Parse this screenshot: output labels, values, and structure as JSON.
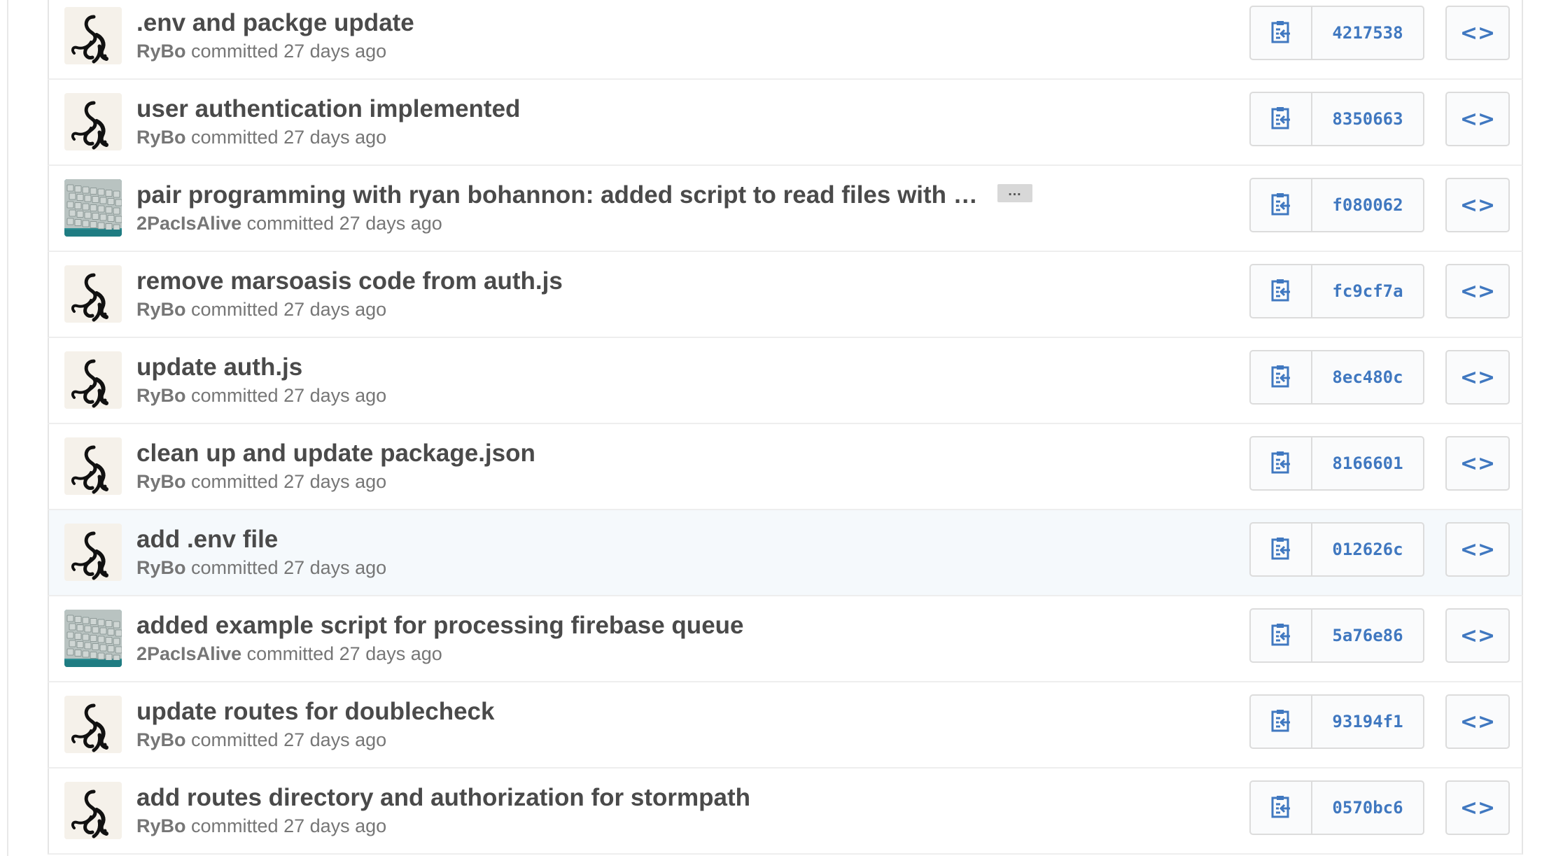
{
  "colors": {
    "link": "#4078c0",
    "title_text": "#4a4a4a",
    "meta_text": "#767676",
    "highlight_row": "#f5f9fc"
  },
  "commits": [
    {
      "title": ".env and packge update",
      "author": "RyBo",
      "meta_suffix": "committed 27 days ago",
      "sha": "4217538",
      "avatar": "octopus",
      "truncated": false,
      "highlight": false
    },
    {
      "title": "user authentication implemented",
      "author": "RyBo",
      "meta_suffix": "committed 27 days ago",
      "sha": "8350663",
      "avatar": "octopus",
      "truncated": false,
      "highlight": false
    },
    {
      "title": "pair programming with ryan bohannon: added script to read files with …",
      "author": "2PacIsAlive",
      "meta_suffix": "committed 27 days ago",
      "sha": "f080062",
      "avatar": "keyboard",
      "truncated": true,
      "ellipsis_label": "…",
      "highlight": false
    },
    {
      "title": "remove marsoasis code from auth.js",
      "author": "RyBo",
      "meta_suffix": "committed 27 days ago",
      "sha": "fc9cf7a",
      "avatar": "octopus",
      "truncated": false,
      "highlight": false
    },
    {
      "title": "update auth.js",
      "author": "RyBo",
      "meta_suffix": "committed 27 days ago",
      "sha": "8ec480c",
      "avatar": "octopus",
      "truncated": false,
      "highlight": false
    },
    {
      "title": "clean up and update package.json",
      "author": "RyBo",
      "meta_suffix": "committed 27 days ago",
      "sha": "8166601",
      "avatar": "octopus",
      "truncated": false,
      "highlight": false
    },
    {
      "title": "add .env file",
      "author": "RyBo",
      "meta_suffix": "committed 27 days ago",
      "sha": "012626c",
      "avatar": "octopus",
      "truncated": false,
      "highlight": true
    },
    {
      "title": "added example script for processing firebase queue",
      "author": "2PacIsAlive",
      "meta_suffix": "committed 27 days ago",
      "sha": "5a76e86",
      "avatar": "keyboard",
      "truncated": false,
      "highlight": false
    },
    {
      "title": "update routes for doublecheck",
      "author": "RyBo",
      "meta_suffix": "committed 27 days ago",
      "sha": "93194f1",
      "avatar": "octopus",
      "truncated": false,
      "highlight": false
    },
    {
      "title": "add routes directory and authorization for stormpath",
      "author": "RyBo",
      "meta_suffix": "committed 27 days ago",
      "sha": "0570bc6",
      "avatar": "octopus",
      "truncated": false,
      "highlight": false
    }
  ],
  "buttons": {
    "browse_label": "<>"
  },
  "icons": {
    "copy": "clippy-icon",
    "browse": "code-icon"
  }
}
